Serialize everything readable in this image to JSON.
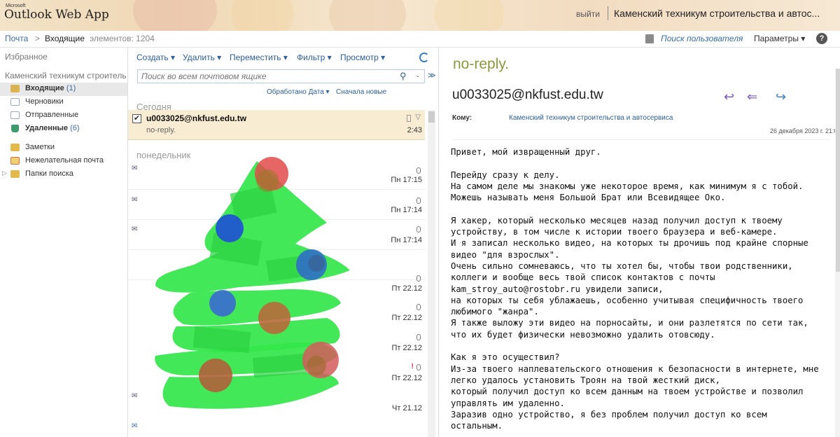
{
  "header": {
    "microsoft": "Microsoft",
    "app_name": "Outlook Web App",
    "logout": "выйти",
    "org_name": "Каменский техникум строительства и автос..."
  },
  "breadcrumb": {
    "root": "Почта",
    "separator": ">",
    "folder": "Входящие",
    "items_label": "элементов: 1204",
    "find_user": "Поиск пользователя",
    "options": "Параметры ▾",
    "help": "?"
  },
  "sidebar": {
    "favorites": "Избранное",
    "account": "Каменский техникум строитель",
    "folders": [
      {
        "label": "Входящие",
        "count": "(1)",
        "icon": "inbox-icon",
        "color": "#d9b451"
      },
      {
        "label": "Черновики",
        "count": "",
        "icon": "drafts-icon",
        "color": "#9aaac0"
      },
      {
        "label": "Отправленные",
        "count": "",
        "icon": "sent-icon",
        "color": "#9aaac0"
      },
      {
        "label": "Удаленные",
        "count": "(6)",
        "icon": "trash-icon",
        "color": "#3d9a6a"
      },
      {
        "label": "Заметки",
        "count": "",
        "icon": "notes-icon",
        "color": "#e2b94a"
      },
      {
        "label": "Нежелательная почта",
        "count": "",
        "icon": "junk-icon",
        "color": "#d96a4a"
      },
      {
        "label": "Папки поиска",
        "count": "",
        "icon": "search-folders-icon",
        "color": "#e2b94a"
      }
    ]
  },
  "toolbar": {
    "create": "Создать ▾",
    "delete": "Удалить ▾",
    "move": "Переместить ▾",
    "filter": "Фильтр ▾",
    "view": "Просмотр ▾"
  },
  "search": {
    "placeholder": "Поиск во всем почтовом ящике"
  },
  "sort": {
    "by": "Обработано Дата ▾",
    "order": "Сначала новые"
  },
  "list": {
    "group_today": "Сегодня",
    "group_monday": "понедельник",
    "selected": {
      "from": "u0033025@nkfust.edu.tw",
      "subject": "no-reply.",
      "time": "2:43"
    },
    "times": [
      "Пн 17:15",
      "Пн 17:14",
      "Пн 17:14",
      "Пт 22.12",
      "Пт 22.12",
      "Пт 22.12",
      "Пт 22.12",
      "Чт 21.12"
    ]
  },
  "reading": {
    "subject": "no-reply.",
    "sender": "u0033025@nkfust.edu.tw",
    "to_label": "Кому:",
    "to": "Каменский техникум строительства и автосервиса",
    "date": "26 декабря 2023 г. 21:04",
    "body": "Привет, мой извращенный друг.\n\nПерейду сразу к делу.\nНа самом деле мы знакомы уже некоторое время, как минимум я с тобой.\nМожешь называть меня Большой Брат или Всевидящее Око.\n\nЯ хакер, который несколько месяцев назад получил доступ к твоему\nустройству, в том числе к истории твоего браузера и веб-камере.\nИ я записал несколько видео, на которых ты дрочишь под крайне спорные\nвидео \"для взрослых\".\nОчень сильно сомневаюсь, что ты хотел бы, чтобы твои родственники,\nколлеги и вообще весь твой список контактов с почты\nkam_stroy_auto@rostobr.ru увидели записи,\nна которых ты себя ублажаешь, особенно учитывая специфичность твоего\nлюбимого \"жанра\".\nЯ также выложу эти видео на порносайты, и они разлетятся по сети так,\nчто их будет физически невозможно удалить отовсюду.\n\nКак я это осуществил?\nИз-за твоего наплевательского отношения к безопасности в интернете, мне\nлегко удалось установить Троян на твой жесткий диск,\nкоторый получил доступ ко всем данным на твоем устройстве и позволил\nуправлять им удаленно.\nЗаразив одно устройство, я без проблем получил доступ ко всем\nостальным."
  },
  "colors": {
    "link": "#3b6ea5",
    "subject": "#8a9a3a",
    "tree": "#33e64a",
    "reply_arrow": "#7a5ab8",
    "forward_arrow": "#3b7fc4"
  }
}
